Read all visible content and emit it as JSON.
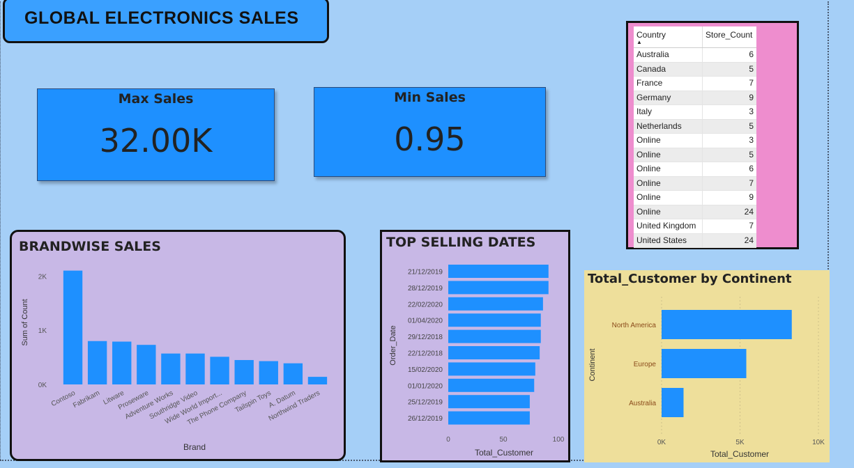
{
  "title": "GLOBAL ELECTRONICS SALES",
  "cards": {
    "max": {
      "label": "Max Sales",
      "value": "32.00K"
    },
    "min": {
      "label": "Min Sales",
      "value": "0.95"
    }
  },
  "store_table": {
    "headers": [
      "Country",
      "Store_Count"
    ],
    "rows": [
      [
        "Australia",
        "6"
      ],
      [
        "Canada",
        "5"
      ],
      [
        "France",
        "7"
      ],
      [
        "Germany",
        "9"
      ],
      [
        "Italy",
        "3"
      ],
      [
        "Netherlands",
        "5"
      ],
      [
        "Online",
        "3"
      ],
      [
        "Online",
        "5"
      ],
      [
        "Online",
        "6"
      ],
      [
        "Online",
        "7"
      ],
      [
        "Online",
        "9"
      ],
      [
        "Online",
        "24"
      ],
      [
        "United Kingdom",
        "7"
      ],
      [
        "United States",
        "24"
      ]
    ]
  },
  "colors": {
    "bar": "#1e90ff",
    "brand_panel": "#c8b8e6",
    "continent_panel": "#eedf9b",
    "table_frame": "#ee8dce"
  },
  "chart_data": [
    {
      "type": "bar",
      "title": "BRANDWISE SALES",
      "xlabel": "Brand",
      "ylabel": "Sum of Count",
      "categories": [
        "Contoso",
        "Fabrikam",
        "Litware",
        "Proseware",
        "Adventure Works",
        "Southridge Video",
        "Wide World Import...",
        "The Phone Company",
        "Tailspin Toys",
        "A. Datum",
        "Northwind Traders"
      ],
      "values": [
        2100,
        800,
        790,
        730,
        570,
        570,
        510,
        450,
        430,
        390,
        140
      ],
      "yticks": [
        "0K",
        "1K",
        "2K"
      ],
      "ylim": [
        0,
        2300
      ]
    },
    {
      "type": "bar",
      "orientation": "horizontal",
      "title": "TOP SELLING DATES",
      "xlabel": "Total_Customer",
      "ylabel": "Order_Date",
      "categories": [
        "21/12/2019",
        "28/12/2019",
        "22/02/2020",
        "01/04/2020",
        "29/12/2018",
        "22/12/2018",
        "15/02/2020",
        "01/01/2020",
        "25/12/2019",
        "26/12/2019"
      ],
      "values": [
        91,
        91,
        86,
        84,
        84,
        83,
        79,
        78,
        74,
        74
      ],
      "xticks": [
        "0",
        "50",
        "100"
      ],
      "xlim": [
        0,
        100
      ]
    },
    {
      "type": "bar",
      "orientation": "horizontal",
      "title": "Total_Customer by Continent",
      "xlabel": "Total_Customer",
      "ylabel": "Continent",
      "categories": [
        "North America",
        "Europe",
        "Australia"
      ],
      "values": [
        8300,
        5400,
        1400
      ],
      "xticks": [
        "0K",
        "5K",
        "10K"
      ],
      "xlim": [
        0,
        10000
      ]
    }
  ]
}
